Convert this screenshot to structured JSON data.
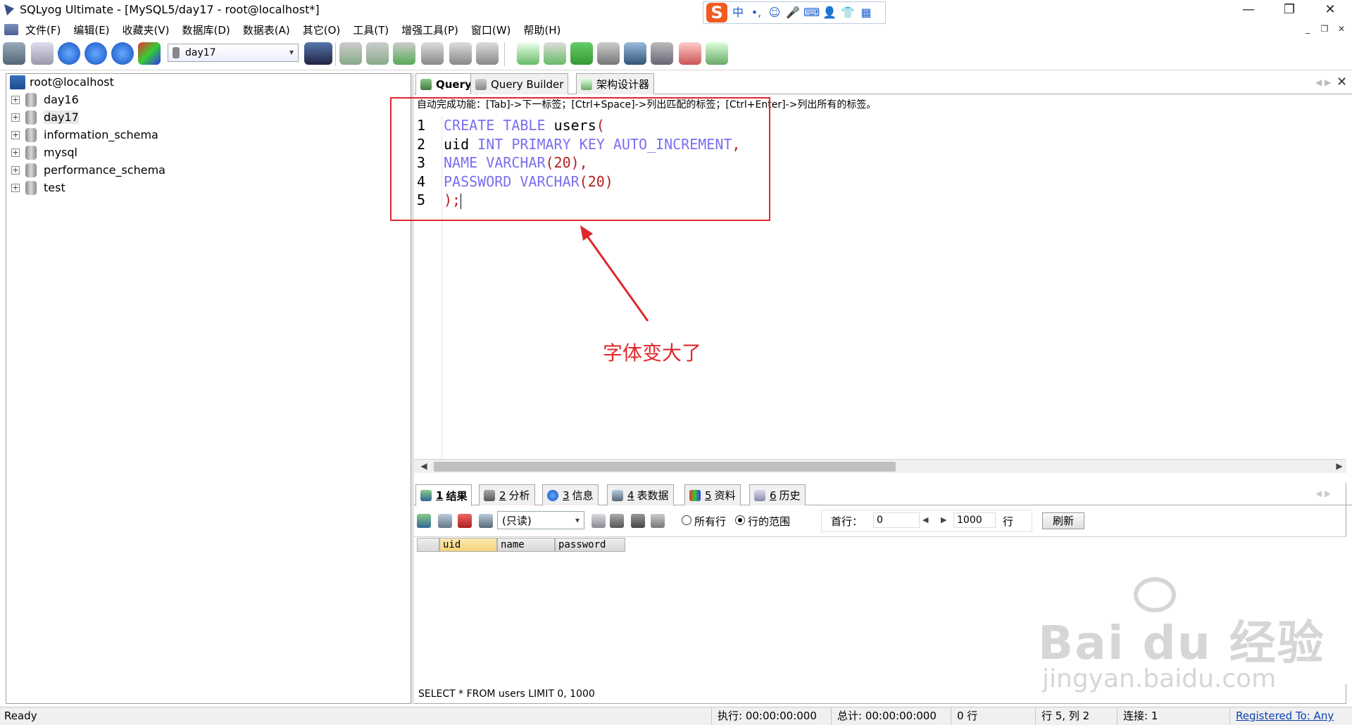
{
  "window": {
    "title": "SQLyog Ultimate - [MySQL5/day17 - root@localhost*]",
    "min_label": "—",
    "restore_label": "❐",
    "close_label": "✕"
  },
  "ime": {
    "logo": "S",
    "items": [
      "中",
      "•,",
      "☺",
      "🎤",
      "⌨",
      "👤",
      "👕",
      "▦"
    ]
  },
  "menu": {
    "items": [
      "文件(F)",
      "编辑(E)",
      "收藏夹(V)",
      "数据库(D)",
      "数据表(A)",
      "其它(O)",
      "工具(T)",
      "增强工具(P)",
      "窗口(W)",
      "帮助(H)"
    ],
    "mdi": [
      "_",
      "❐",
      "✕"
    ]
  },
  "toolbar": {
    "database_selected": "day17"
  },
  "tree": {
    "root": "root@localhost",
    "databases": [
      "day16",
      "day17",
      "information_schema",
      "mysql",
      "performance_schema",
      "test"
    ]
  },
  "editor_tabs": [
    {
      "label": "Query"
    },
    {
      "label": "Query Builder"
    },
    {
      "label": "架构设计器"
    }
  ],
  "editor": {
    "autocomplete_hint": "自动完成功能：[Tab]->下一标签；[Ctrl+Space]->列出匹配的标签；[Ctrl+Enter]->列出所有的标签。",
    "lines": [
      {
        "no": "1",
        "tokens": [
          {
            "t": "CREATE TABLE ",
            "c": "kw"
          },
          {
            "t": "users",
            "c": "id"
          },
          {
            "t": "(",
            "c": "punc"
          }
        ]
      },
      {
        "no": "2",
        "tokens": [
          {
            "t": "uid ",
            "c": "id"
          },
          {
            "t": "INT PRIMARY KEY AUTO_INCREMENT",
            "c": "kw"
          },
          {
            "t": ",",
            "c": "punc"
          }
        ]
      },
      {
        "no": "3",
        "tokens": [
          {
            "t": "NAME VARCHAR",
            "c": "kw"
          },
          {
            "t": "(20),",
            "c": "num"
          }
        ]
      },
      {
        "no": "4",
        "tokens": [
          {
            "t": "PASSWORD VARCHAR",
            "c": "kw"
          },
          {
            "t": "(20)",
            "c": "num"
          }
        ]
      },
      {
        "no": "5",
        "tokens": [
          {
            "t": ");",
            "c": "punc"
          }
        ]
      }
    ]
  },
  "annotation": {
    "text": "字体变大了",
    "color": "#e0282c"
  },
  "result_tabs": [
    {
      "num": "1",
      "label": "结果"
    },
    {
      "num": "2",
      "label": "分析"
    },
    {
      "num": "3",
      "label": "信息"
    },
    {
      "num": "4",
      "label": "表数据"
    },
    {
      "num": "5",
      "label": "资料"
    },
    {
      "num": "6",
      "label": "历史"
    }
  ],
  "result_toolbar": {
    "mode": "(只读)",
    "all_rows": "所有行",
    "row_range": "行的范围",
    "first_row_label": "首行：",
    "first_row_value": "0",
    "row_count_value": "1000",
    "rows_label": "行",
    "refresh": "刷新"
  },
  "grid": {
    "columns": [
      "uid",
      "name",
      "password"
    ]
  },
  "last_query": "SELECT * FROM users LIMIT 0, 1000",
  "watermark": {
    "main": "Bai du 经验",
    "sub": "jingyan.baidu.com"
  },
  "status": {
    "ready": "Ready",
    "exec": "执行: 00:00:00:000",
    "total": "总计: 00:00:00:000",
    "rows": "0 行",
    "position": "行 5, 列 2",
    "connections": "连接: 1",
    "registered": "Registered To: Any"
  }
}
